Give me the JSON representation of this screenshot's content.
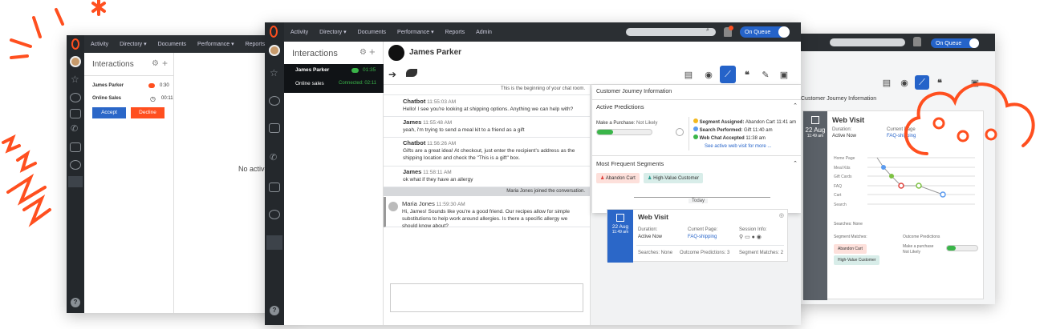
{
  "colors": {
    "accent": "#ff4f1f",
    "nav": "#2b2f33",
    "blue": "#2563c9",
    "accept": "#2b67c8",
    "decline": "#ff4f1f",
    "green": "#3ab549"
  },
  "nav": {
    "activity": "Activity",
    "directory": "Directory ▾",
    "documents": "Documents",
    "performance": "Performance ▾",
    "reports": "Reports",
    "admin": "Admin"
  },
  "queue_label": "On Queue",
  "left": {
    "title": "Interactions",
    "items": [
      {
        "name": "James Parker",
        "time": "0:30"
      },
      {
        "name": "Online Sales",
        "time": "00:11"
      }
    ],
    "accept": "Accept",
    "decline": "Decline",
    "no_active": "No active"
  },
  "center": {
    "title": "Interactions",
    "contact": "James Parker",
    "items": [
      {
        "name": "James Parker",
        "time": "01:35"
      },
      {
        "name": "Online sales",
        "status": "Connected: 02:11"
      }
    ],
    "chat_start": "This is the beginning of your chat room.",
    "messages": [
      {
        "author": "Chatbot",
        "time": "11:55:03 AM",
        "text": "Hello! I see you're looking at shipping options. Anything we can help with?"
      },
      {
        "author": "James",
        "time": "11:55:48 AM",
        "text": "yeah, i'm trying to send a meal kit to a friend as a gift"
      },
      {
        "author": "Chatbot",
        "time": "11:56:26 AM",
        "text": "Gifts are a great idea! At checkout, just enter the recipient's address as the shipping location and check the \"This is a gift\" box."
      },
      {
        "author": "James",
        "time": "11:58:11 AM",
        "text": "ok what if they have an allergy"
      }
    ],
    "joined": "Maria Jones joined the conversation.",
    "maria": {
      "author": "Maria Jones",
      "time": "11:59:30 AM",
      "text": "Hi, James! Sounds like you're a good friend. Our recipes allow for simple substitutions to help work around allergies. Is there a specific allergy we should know about?"
    },
    "journey": {
      "title": "Customer Journey Information",
      "predictions_title": "Active Predictions",
      "purchase_label": "Make a Purchase:",
      "purchase_value": "Not Likely",
      "purchase_level": 0.3,
      "events": [
        {
          "label": "Segment Assigned:",
          "value": "Abandon Cart",
          "time": "11:41 am"
        },
        {
          "label": "Search Performed:",
          "value": "Gift",
          "time": "11:40 am"
        },
        {
          "label": "Web Chat Accepted",
          "value": "",
          "time": "11:38 am"
        }
      ],
      "see_more": "See active web visit for more ...",
      "segments_title": "Most Frequent Segments",
      "segments": [
        "Abandon Cart",
        "High-Value Customer"
      ],
      "today": "Today",
      "visit": {
        "title": "Web Visit",
        "date": "22 Aug",
        "time": "11:49 am",
        "duration_label": "Duration:",
        "duration": "Active Now",
        "page_label": "Current Page:",
        "page": "FAQ-shipping",
        "session_label": "Session Info:",
        "searches": "Searches: None",
        "outcomes": "Outcome Predictions: 3",
        "matches": "Segment Matches: 2"
      }
    }
  },
  "right": {
    "journey_title": "Customer Journey Information",
    "visit_title": "Web Visit",
    "date": "22 Aug",
    "time": "11:49 am",
    "duration_label": "Duration:",
    "duration": "Active Now",
    "page_label": "Current Page",
    "page": "FAQ-shipping",
    "pages": [
      "Home Page",
      "Meal Kits",
      "Gift Cards",
      "FAQ",
      "Cart",
      "Search"
    ],
    "searches": "Searches: None",
    "segment_matches": "Segment Matches:",
    "outcome_predictions": "Outcome Predictions",
    "segments": [
      "Abandon Cart",
      "High-Value Customer"
    ],
    "purchase": "Make a purchase",
    "not_likely": "Not Likely"
  }
}
